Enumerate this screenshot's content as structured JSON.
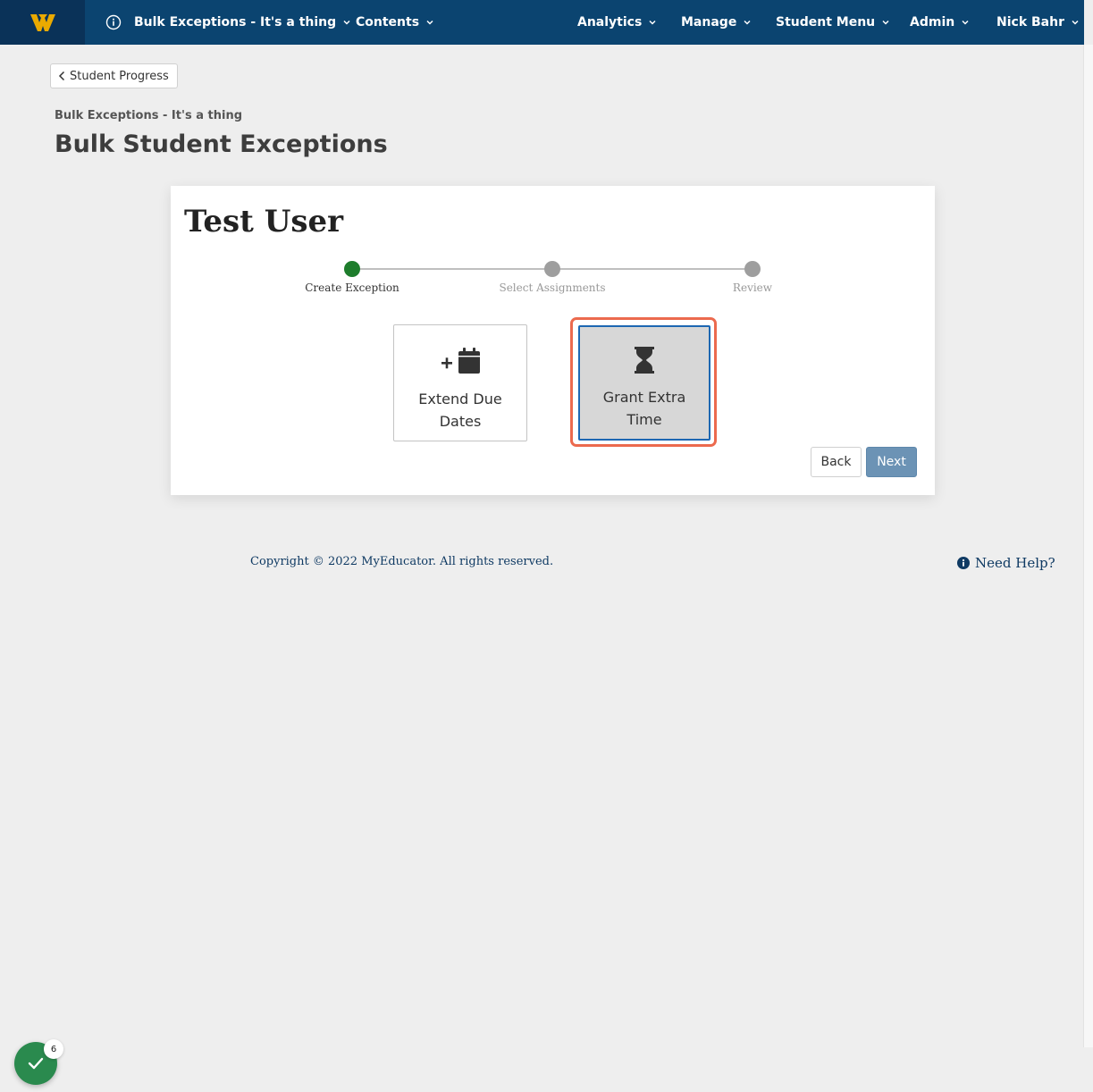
{
  "nav": {
    "course_title": "Bulk Exceptions - It's a thing",
    "contents": "Contents",
    "analytics": "Analytics",
    "manage": "Manage",
    "student_menu": "Student Menu",
    "admin": "Admin",
    "user": "Nick Bahr"
  },
  "breadcrumb": {
    "back_label": "Student Progress"
  },
  "header": {
    "course_name": "Bulk Exceptions - It's a thing",
    "page_title": "Bulk Student Exceptions"
  },
  "card": {
    "student_name": "Test User",
    "steps": [
      {
        "label": "Create Exception",
        "state": "active"
      },
      {
        "label": "Select Assignments",
        "state": "pending"
      },
      {
        "label": "Review",
        "state": "pending"
      }
    ],
    "options": [
      {
        "label": "Extend Due Dates",
        "icon": "calendar-plus-icon",
        "selected": false
      },
      {
        "label": "Grant Extra Time",
        "icon": "hourglass-icon",
        "selected": true
      }
    ],
    "back_button": "Back",
    "next_button": "Next"
  },
  "footer": {
    "copyright": "Copyright © 2022 MyEducator. All rights reserved.",
    "help": "Need Help?"
  },
  "widget": {
    "count": "6"
  },
  "colors": {
    "nav_bg": "#0b4470",
    "logo_bg": "#0a3258",
    "logo_gold": "#eaaa00",
    "active_step": "#1e7d2c",
    "focus_ring": "#ec6a4e",
    "selected_border": "#1d67b2",
    "next_button": "#6c93b5",
    "widget_green": "#2a8a4e"
  }
}
